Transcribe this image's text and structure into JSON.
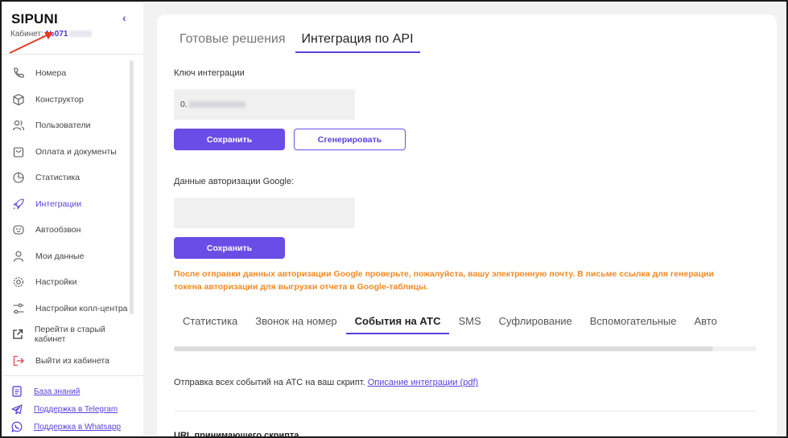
{
  "sidebar": {
    "logo": "SIPUNI",
    "collapse_icon": "chevron-left-icon",
    "cabinet_label": "Кабинет",
    "cabinet_number": "№071",
    "nav": [
      {
        "label": "Номера",
        "icon": "phone-icon"
      },
      {
        "label": "Конструктор",
        "icon": "cube-icon"
      },
      {
        "label": "Пользователи",
        "icon": "users-icon"
      },
      {
        "label": "Оплата и документы",
        "icon": "bag-icon"
      },
      {
        "label": "Статистика",
        "icon": "pie-chart-icon"
      },
      {
        "label": "Интеграции",
        "icon": "rocket-icon",
        "active": true
      },
      {
        "label": "Автообзвон",
        "icon": "robot-icon"
      },
      {
        "label": "Мои данные",
        "icon": "user-icon"
      },
      {
        "label": "Настройки",
        "icon": "gear-icon"
      },
      {
        "label": "Настройки колл-центра",
        "icon": "sliders-icon"
      },
      {
        "label": "Перейти в старый кабинет",
        "icon": "external-link-icon"
      },
      {
        "label": "Выйти из кабинета",
        "icon": "logout-icon"
      }
    ],
    "support": [
      {
        "label": "База знаний",
        "icon": "document-icon"
      },
      {
        "label": "Поддержка в Telegram",
        "icon": "telegram-icon"
      },
      {
        "label": "Поддержка в Whatsapp",
        "icon": "whatsapp-icon"
      }
    ]
  },
  "main": {
    "tabs": [
      {
        "label": "Готовые решения",
        "active": false
      },
      {
        "label": "Интеграция по API",
        "active": true
      }
    ],
    "integration_key_label": "Ключ интеграции",
    "integration_key_value": "0.",
    "save_label": "Сохранить",
    "generate_label": "Сгенерировать",
    "google_auth_label": "Данные авторизации Google:",
    "google_auth_value": "",
    "save2_label": "Сохранить",
    "notice": "После отправки данных авторизации Google проверьте, пожалуйста, вашу электронную почту. В письме ссылка для генерации токена авторизации для выгрузки отчета в Google-таблицы.",
    "sub_tabs": [
      {
        "label": "Статистика",
        "active": false
      },
      {
        "label": "Звонок на номер",
        "active": false
      },
      {
        "label": "События на АТС",
        "active": true
      },
      {
        "label": "SMS",
        "active": false
      },
      {
        "label": "Суфлирование",
        "active": false
      },
      {
        "label": "Вспомогательные",
        "active": false
      },
      {
        "label": "Авто",
        "active": false
      }
    ],
    "description_text": "Отправка всех событий на АТС на ваш скрипт.",
    "description_link": "Описание интеграции (pdf)",
    "url_label": "URL принимающего скрипта"
  },
  "colors": {
    "accent": "#6a4de6",
    "notice": "#f08a24",
    "annotation_arrow": "#e8391f"
  }
}
